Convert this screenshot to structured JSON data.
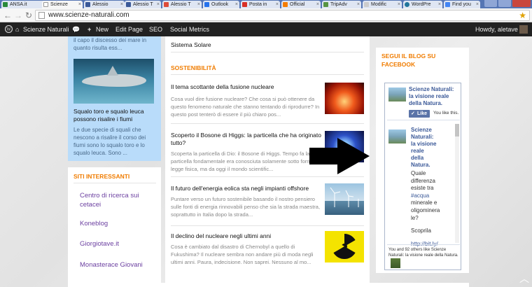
{
  "browser": {
    "tabs": [
      {
        "label": "ANSA.it",
        "color": "#2a8a3a"
      },
      {
        "label": "Scienze",
        "color": "#ffffff"
      },
      {
        "label": "Alessio",
        "color": "#3b5998"
      },
      {
        "label": "Alessio T",
        "color": "#3b5998"
      },
      {
        "label": "Alessio T",
        "color": "#dd4b39"
      },
      {
        "label": "Outlook",
        "color": "#2672ec"
      },
      {
        "label": "Posta in",
        "color": "#d93025"
      },
      {
        "label": "Official",
        "color": "#f57d00"
      },
      {
        "label": "TripAdv",
        "color": "#589442"
      },
      {
        "label": "Modific",
        "color": "#cccccc"
      },
      {
        "label": "WordPre",
        "color": "#21759b"
      },
      {
        "label": "Find you",
        "color": "#4285f4"
      }
    ],
    "url": "www.scienze-naturali.com"
  },
  "wpbar": {
    "site": "Scienze Naturali",
    "new": "New",
    "edit": "Edit Page",
    "seo": "SEO",
    "social": "Social Metrics",
    "howdy": "Howdy, aletave"
  },
  "left_post": {
    "excerpt_top": "il capo il discesso dei mare in quanto risulta ess...",
    "title": "Squalo toro e squalo leuca possono risalire i fiumi",
    "excerpt": "Le due specie di squali che nescono a risalire il corso dei fiumi sono lo squalo toro e lo squalo leuca. Sono ..."
  },
  "siti": {
    "heading": "SITI INTERESSANTI",
    "links": [
      "Centro di ricerca sui cetacei",
      "Koneblog",
      "Giorgiotave.it",
      "Monasterace Giovani"
    ]
  },
  "main": {
    "prev_link": "Sistema Solare",
    "section": "SOSTENIBILITÀ",
    "posts": [
      {
        "title": "Il tema scottante della fusione nucleare",
        "excerpt": "Cosa vuol dire fusione nucleare? Che cosa si può ottenere da questo fenomeno naturale che stanno tentando di riprodurre? In questo post tenterò di essere il più chiaro pos..."
      },
      {
        "title": "Scoperto il Bosone di Higgs: la particella che ha originato tutto?",
        "excerpt": "Scoperta la particella di Dio: il Bosone di Higgs. Tempo fa la particella fondamentale era conosciuta solamente sotto forma di legge fisica, ma da oggi il mondo scientific..."
      },
      {
        "title": "Il futuro dell'energia eolica sta negli impianti offshore",
        "excerpt": "Puntare verso un futuro sostenibile basando il nostro pensiero sulle fonti di energia rinnovabili penso che sia la strada maestra, soprattutto in Italia dopo la strada..."
      },
      {
        "title": "Il declino del nucleare negli ultimi anni",
        "excerpt": "Cosa è cambiato dal disastro di Chernobyl a quello di Fukushima? Il nucleare sembra non andare più di moda negli ultimi anni. Paura, indecisione. Non saprei. Nessuno al mo..."
      }
    ]
  },
  "facebook": {
    "heading": "SEGUI IL BLOG SU FACEBOOK",
    "page_name": "Scienze Naturali: la visione reale della Natura.",
    "like": "Like",
    "you_like": "You like this.",
    "post_name_lines": [
      "Scienze",
      "Naturali:",
      "la visione",
      "reale",
      "della",
      "Natura."
    ],
    "post_text_lines": [
      "Quale",
      "differenza",
      "esiste tra",
      "#acqua",
      "minerale e",
      "oligominera",
      "le?",
      "",
      "Scoprila",
      "",
      "http://bit.ly/"
    ],
    "footer": "You and 92 others like Scienze Naturali: la visione reale della Natura."
  }
}
